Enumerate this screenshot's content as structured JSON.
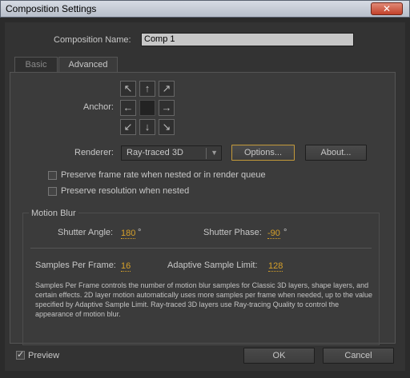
{
  "window": {
    "title": "Composition Settings",
    "close_glyph": "✕"
  },
  "comp": {
    "name_label": "Composition Name:",
    "name_value": "Comp 1"
  },
  "tabs": [
    {
      "label": "Basic"
    },
    {
      "label": "Advanced"
    }
  ],
  "anchor": {
    "label": "Anchor:",
    "arrows": [
      "↖",
      "↑",
      "↗",
      "←",
      "",
      "→",
      "↙",
      "↓",
      "↘"
    ]
  },
  "renderer": {
    "label": "Renderer:",
    "value": "Ray-traced 3D",
    "dropdown_arrow": "▼",
    "options_label": "Options...",
    "about_label": "About..."
  },
  "checkboxes": {
    "preserve_frame_rate": "Preserve frame rate when nested or in render queue",
    "preserve_resolution": "Preserve resolution when nested"
  },
  "motion_blur": {
    "title": "Motion Blur",
    "shutter_angle_label": "Shutter Angle:",
    "shutter_angle_value": "180",
    "shutter_angle_unit": "°",
    "shutter_phase_label": "Shutter Phase:",
    "shutter_phase_value": "-90",
    "shutter_phase_unit": "°",
    "samples_per_frame_label": "Samples Per Frame:",
    "samples_per_frame_value": "16",
    "adaptive_limit_label": "Adaptive Sample Limit:",
    "adaptive_limit_value": "128",
    "description": "Samples Per Frame controls the number of motion blur samples for Classic 3D layers, shape layers, and certain effects. 2D layer motion automatically uses more samples per frame when needed, up to the value specified by Adaptive Sample Limit. Ray-traced 3D layers use Ray-tracing Quality to control the appearance of motion blur."
  },
  "footer": {
    "preview_label": "Preview",
    "ok_label": "OK",
    "cancel_label": "Cancel"
  },
  "colors": {
    "accent": "#d6a02a",
    "focus_border": "#c49a3a"
  }
}
